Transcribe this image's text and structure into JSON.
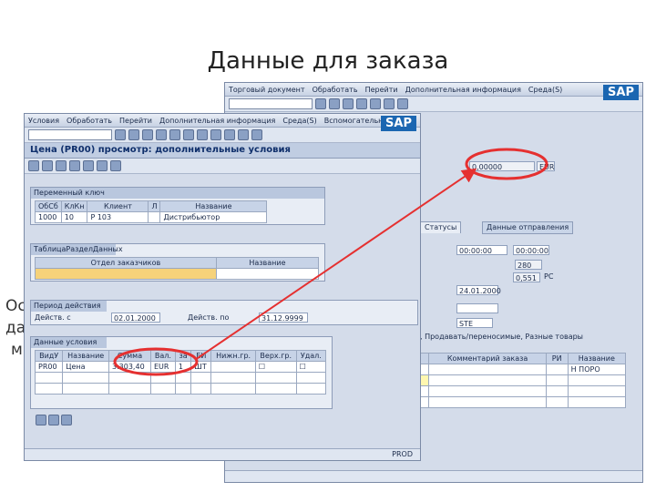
{
  "slide": {
    "title": "Данные для заказа",
    "left_text_1": "Ос",
    "left_text_2": "да",
    "left_text_3": "м"
  },
  "back_window": {
    "menu": [
      "Торговый документ",
      "Обработать",
      "Перейти",
      "Дополнительная информация",
      "Среда(S)"
    ],
    "sap_logo": "SAP",
    "fields_top": [
      "0,00000",
      "EUR"
    ],
    "tabs": [
      "Статусы",
      "Данные отправления"
    ],
    "values": [
      "00:00:00",
      "00:00:00",
      "280",
      "0,551",
      "PC",
      "24.01.2000",
      "STE"
    ],
    "row_text": ", Продавать/переносимые, Разные товары",
    "col_headers": [
      "Комментарий заказа",
      "РИ",
      "Название"
    ],
    "status": "Н ПОРО"
  },
  "front_window": {
    "menu": [
      "Условия",
      "Обработать",
      "Перейти",
      "Дополнительная информация",
      "Среда(S)",
      "Вспомогательные"
    ],
    "sap_logo": "SAP",
    "screen_title": "Цена (PR00) просмотр: дополнительные условия",
    "group1": {
      "header": "Переменный ключ",
      "columns": [
        "ОбСб",
        "КлКн",
        "Клиент",
        "Л",
        "Название"
      ],
      "row": [
        "1000",
        "10",
        "P 103",
        "",
        "Дистрибьютор"
      ]
    },
    "group2": {
      "header": "ТаблицаРазделДанных",
      "columns": [
        "Отдел заказчиков",
        "Название"
      ]
    },
    "group3": {
      "header": "Период действия",
      "valid_from_label": "Действ. с",
      "valid_from": "02.01.2000",
      "valid_to_label": "Действ. по",
      "valid_to": "31.12.9999"
    },
    "group4": {
      "header": "Данные условия",
      "columns": [
        "ВидУ",
        "Название",
        "Сумма",
        "Вал.",
        "за",
        "ЕИ",
        "Нижн.гр.",
        "Верх.гр.",
        "Удал."
      ],
      "row": [
        "PR00",
        "Цена",
        "3.303,40",
        "EUR",
        "1",
        "ШТ",
        "",
        "",
        ""
      ]
    },
    "status": "PROD"
  },
  "colors": {
    "highlight": "#e53030",
    "sap_blue": "#1b66b1"
  }
}
